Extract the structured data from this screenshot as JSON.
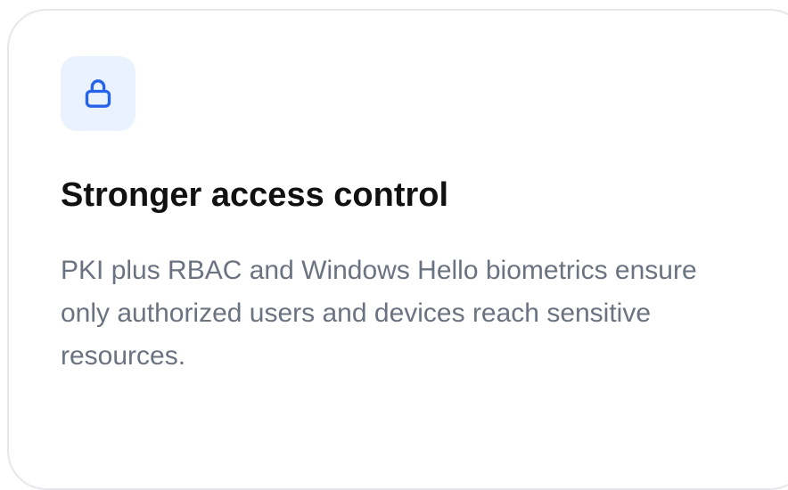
{
  "card": {
    "icon": "lock-icon",
    "title": "Stronger access control",
    "description": "PKI plus RBAC and Windows Hello biometrics ensure only authorized users and devices reach sensitive resources."
  },
  "colors": {
    "accent": "#2563eb",
    "icon_background": "#eaf1ff",
    "title": "#111111",
    "body_text": "#6b7280",
    "card_border": "#e5e7eb"
  }
}
